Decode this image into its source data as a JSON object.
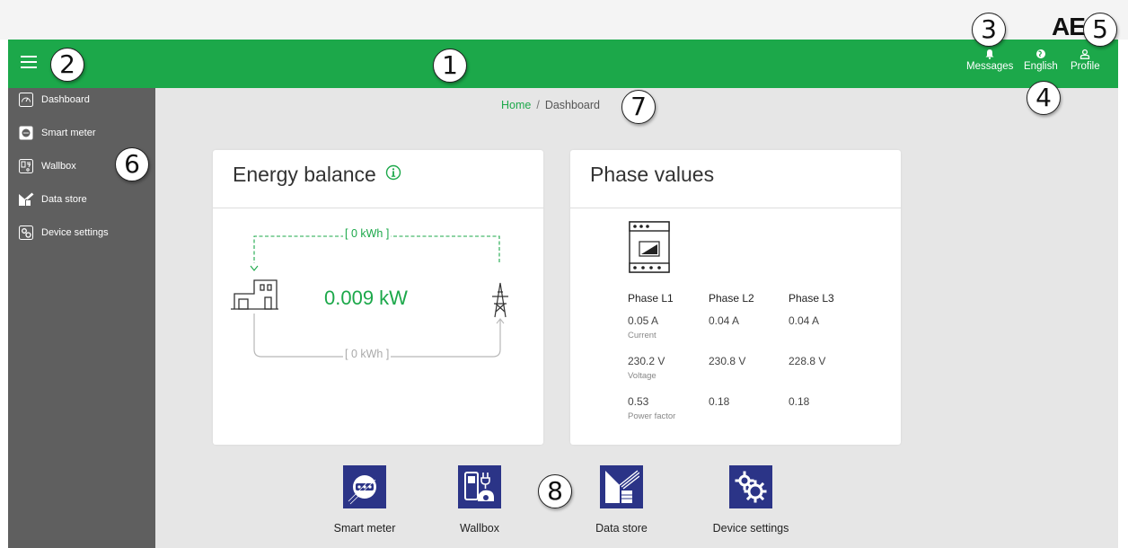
{
  "brand": {
    "logo_text": "AE"
  },
  "header": {
    "messages_label": "Messages",
    "language_label": "English",
    "profile_label": "Profile"
  },
  "callouts": [
    "1",
    "2",
    "3",
    "4",
    "5",
    "6",
    "7",
    "8"
  ],
  "sidebar": {
    "items": [
      {
        "label": "Dashboard",
        "icon": "gauge-icon"
      },
      {
        "label": "Smart meter",
        "icon": "smart-meter-icon"
      },
      {
        "label": "Wallbox",
        "icon": "wallbox-icon"
      },
      {
        "label": "Data store",
        "icon": "data-store-icon"
      },
      {
        "label": "Device settings",
        "icon": "gears-icon"
      }
    ]
  },
  "breadcrumb": {
    "home": "Home",
    "separator": "/",
    "current": "Dashboard"
  },
  "energy_balance": {
    "title": "Energy balance",
    "info_icon": "info-icon",
    "top_flow": "[ 0 kWh ]",
    "bottom_flow": "[ 0 kWh ]",
    "current_power": "0.009 kW"
  },
  "phase_values": {
    "title": "Phase values",
    "headers": [
      "Phase L1",
      "Phase L2",
      "Phase L3"
    ],
    "rows": [
      {
        "values": [
          "0.05 A",
          "0.04 A",
          "0.04 A"
        ],
        "label": "Current"
      },
      {
        "values": [
          "230.2 V",
          "230.8 V",
          "228.8 V"
        ],
        "label": "Voltage"
      },
      {
        "values": [
          "0.53",
          "0.18",
          "0.18"
        ],
        "label": "Power factor"
      }
    ]
  },
  "tiles": [
    {
      "label": "Smart meter",
      "icon": "smart-meter-icon"
    },
    {
      "label": "Wallbox",
      "icon": "wallbox-icon"
    },
    {
      "label": "Data store",
      "icon": "data-store-icon"
    },
    {
      "label": "Device settings",
      "icon": "gears-icon"
    }
  ],
  "colors": {
    "accent_green": "#1ca84a",
    "sidebar_gray": "#5f5f5f",
    "tile_blue": "#2b3487",
    "content_bg": "#e6e6e6"
  }
}
